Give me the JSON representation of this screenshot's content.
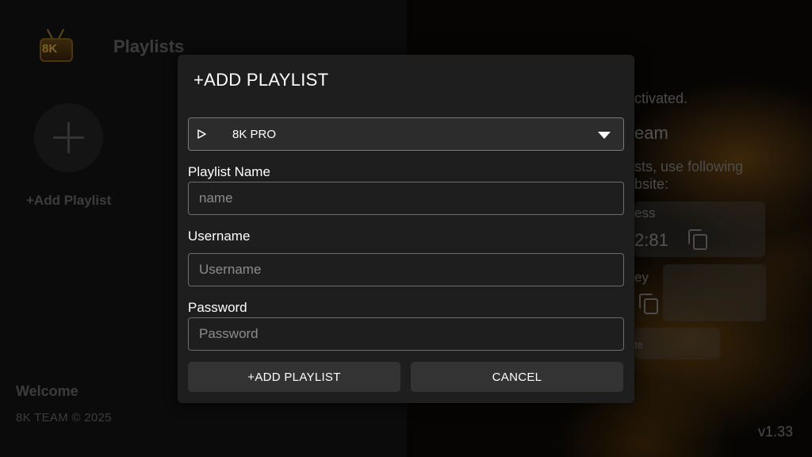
{
  "app": {
    "logo_text": "8K",
    "title": "Playlists",
    "add_playlist_label": "+Add Playlist",
    "welcome": "Welcome",
    "copyright": "8K TEAM © 2025",
    "version": "v1.33"
  },
  "background_panel": {
    "line1": "ctivated.",
    "line2": "eam",
    "line3": "sts, use following",
    "line4": "bsite:",
    "line5": "ess",
    "line6": "2:81",
    "line7": "ey",
    "line8": "te"
  },
  "dialog": {
    "title": "+ADD PLAYLIST",
    "playlist_type": {
      "selected": "8K PRO",
      "icon": "play-outline-icon"
    },
    "fields": {
      "name_label": "Playlist Name",
      "name_placeholder": "name",
      "name_value": "",
      "username_label": "Username",
      "username_placeholder": "Username",
      "username_value": "",
      "password_label": "Password",
      "password_placeholder": "Password",
      "password_value": ""
    },
    "buttons": {
      "add": "+ADD PLAYLIST",
      "cancel": "CANCEL"
    }
  },
  "colors": {
    "dialog_bg": "#1e1e1e",
    "button_bg": "#333333",
    "select_bg": "#2c2c2c",
    "accent_gold": "#e7b24c"
  }
}
